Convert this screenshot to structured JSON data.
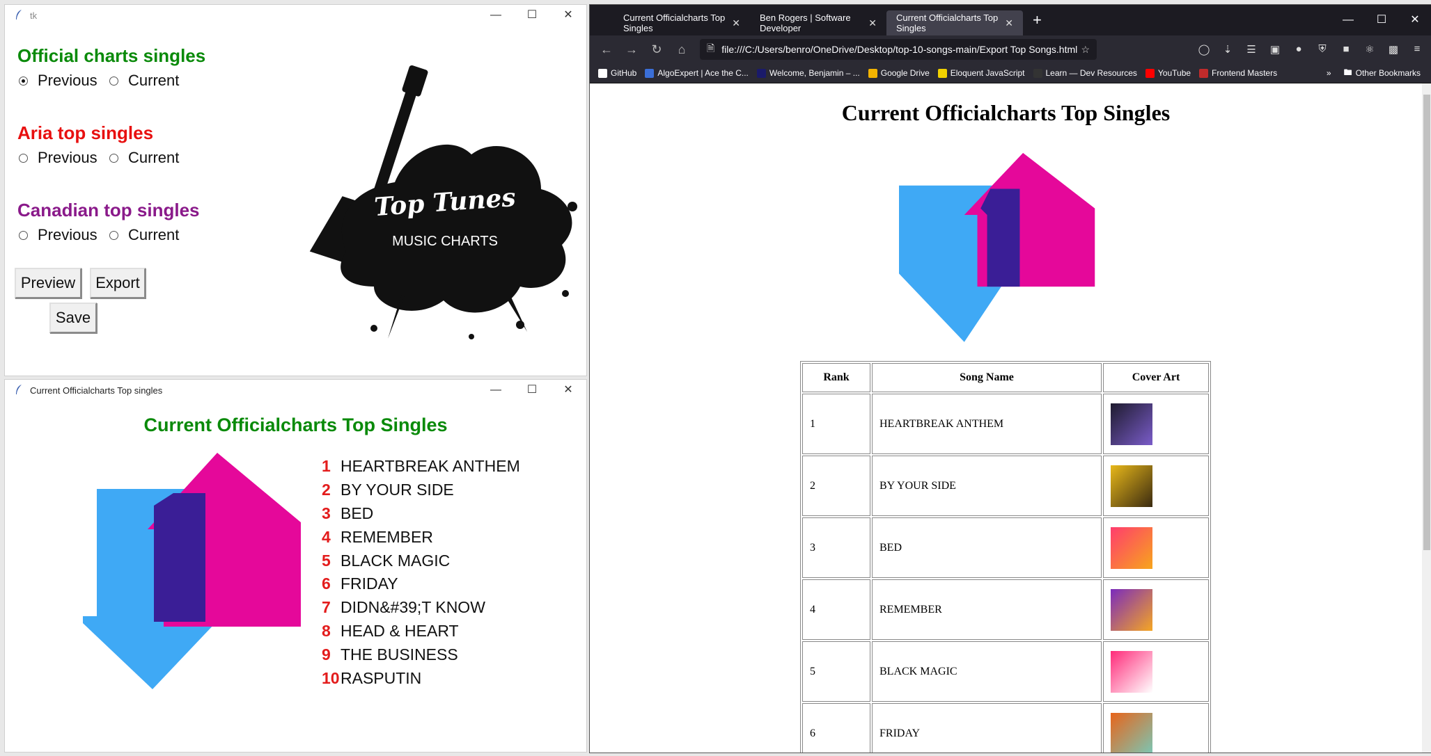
{
  "tk_main": {
    "title": "tk",
    "sections": [
      {
        "heading": "Official charts singles",
        "color": "#0a8a0a",
        "options": [
          "Previous",
          "Current"
        ],
        "selected": "Previous"
      },
      {
        "heading": "Aria top singles",
        "color": "#e81010",
        "options": [
          "Previous",
          "Current"
        ],
        "selected": ""
      },
      {
        "heading": "Canadian top singles",
        "color": "#8a1a8a",
        "options": [
          "Previous",
          "Current"
        ],
        "selected": ""
      }
    ],
    "buttons": {
      "preview": "Preview",
      "export": "Export",
      "save": "Save"
    },
    "logo": {
      "line1": "Top Tunes",
      "line2": "MUSIC CHARTS"
    }
  },
  "tk_chart": {
    "title": "Current Officialcharts Top singles",
    "heading": "Current Officialcharts Top Singles",
    "songs": [
      {
        "rank": "1",
        "name": "HEARTBREAK ANTHEM"
      },
      {
        "rank": "2",
        "name": "BY YOUR SIDE"
      },
      {
        "rank": "3",
        "name": "BED"
      },
      {
        "rank": "4",
        "name": "REMEMBER"
      },
      {
        "rank": "5",
        "name": "BLACK MAGIC"
      },
      {
        "rank": "6",
        "name": "FRIDAY"
      },
      {
        "rank": "7",
        "name": "DIDN&#39;T KNOW"
      },
      {
        "rank": "8",
        "name": "HEAD & HEART"
      },
      {
        "rank": "9",
        "name": "THE BUSINESS"
      },
      {
        "rank": "10",
        "name": "RASPUTIN"
      }
    ]
  },
  "browser": {
    "tabs": [
      {
        "label": "Current Officialcharts Top Singles",
        "active": false
      },
      {
        "label": "Ben Rogers | Software Developer",
        "active": false
      },
      {
        "label": "Current Officialcharts Top Singles",
        "active": true
      }
    ],
    "url": "file:///C:/Users/benro/OneDrive/Desktop/top-10-songs-main/Export Top Songs.html",
    "bookmarks": [
      {
        "label": "GitHub",
        "color": "#ffffff"
      },
      {
        "label": "AlgoExpert | Ace the C...",
        "color": "#3b6fd8"
      },
      {
        "label": "Welcome, Benjamin – ...",
        "color": "#1a1a6a"
      },
      {
        "label": "Google Drive",
        "color": "#f4b400"
      },
      {
        "label": "Eloquent JavaScript",
        "color": "#f2d200"
      },
      {
        "label": "Learn — Dev Resources",
        "color": "#333333"
      },
      {
        "label": "YouTube",
        "color": "#ff0000"
      },
      {
        "label": "Frontend Masters",
        "color": "#c02b2b"
      }
    ],
    "other_bookmarks": "Other Bookmarks",
    "page": {
      "heading": "Current Officialcharts Top Singles",
      "columns": [
        "Rank",
        "Song Name",
        "Cover Art"
      ],
      "rows": [
        {
          "rank": "1",
          "name": "HEARTBREAK ANTHEM",
          "art": [
            "#1e1b2e",
            "#7a5cc9"
          ]
        },
        {
          "rank": "2",
          "name": "BY YOUR SIDE",
          "art": [
            "#e8b81a",
            "#3a2a10"
          ]
        },
        {
          "rank": "3",
          "name": "BED",
          "art": [
            "#ff3c6e",
            "#f7a51c"
          ]
        },
        {
          "rank": "4",
          "name": "REMEMBER",
          "art": [
            "#7a2bbd",
            "#f5a623"
          ]
        },
        {
          "rank": "5",
          "name": "BLACK MAGIC",
          "art": [
            "#ff2a79",
            "#ffffff"
          ]
        },
        {
          "rank": "6",
          "name": "FRIDAY",
          "art": [
            "#e8641a",
            "#7ac7b5"
          ]
        }
      ]
    }
  },
  "colors": {
    "arrow_blue": "#3fa9f5",
    "arrow_pink": "#e5089a",
    "arrow_overlap": "#3a1e96",
    "rank_red": "#e31c1c"
  }
}
